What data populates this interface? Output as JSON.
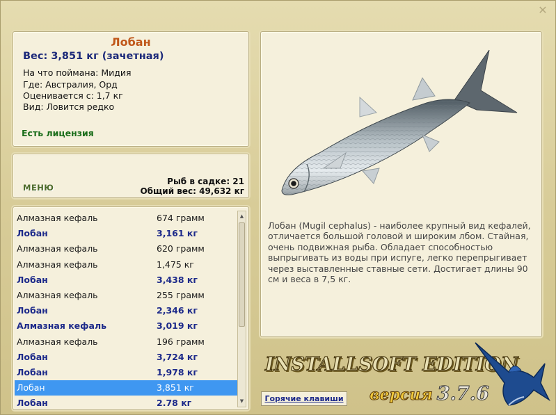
{
  "info": {
    "fish_name": "Лобан",
    "weight_line": "Вес: 3,851 кг (зачетная)",
    "caught_on": "На что поймана: Мидия",
    "location": "Где: Австралия, Орд",
    "valued_from": "Оценивается с: 1,7 кг",
    "kind": "Вид: Ловится редко",
    "license": "Есть лицензия"
  },
  "stats": {
    "menu_label": "МЕНЮ",
    "fish_in_keepnet": "Рыб в садке: 21",
    "total_weight": "Общий вес: 49,632 кг"
  },
  "catch_list": [
    {
      "name": "Алмазная кефаль",
      "weight": "674 грамм",
      "style": "normal"
    },
    {
      "name": "Лобан",
      "weight": "3,161 кг",
      "style": "bold"
    },
    {
      "name": "Алмазная кефаль",
      "weight": "620 грамм",
      "style": "normal"
    },
    {
      "name": "Алмазная кефаль",
      "weight": "1,475 кг",
      "style": "normal"
    },
    {
      "name": "Лобан",
      "weight": "3,438 кг",
      "style": "bold"
    },
    {
      "name": "Алмазная кефаль",
      "weight": "255 грамм",
      "style": "normal"
    },
    {
      "name": "Лобан",
      "weight": "2,346 кг",
      "style": "bold"
    },
    {
      "name": "Алмазная кефаль",
      "weight": "3,019 кг",
      "style": "bold"
    },
    {
      "name": "Алмазная кефаль",
      "weight": "196 грамм",
      "style": "normal"
    },
    {
      "name": "Лобан",
      "weight": "3,724 кг",
      "style": "bold"
    },
    {
      "name": "Лобан",
      "weight": "1,978 кг",
      "style": "bold"
    },
    {
      "name": "Лобан",
      "weight": "3,851 кг",
      "style": "sel"
    },
    {
      "name": "Лобан",
      "weight": "2.78 кг",
      "style": "bold"
    }
  ],
  "fish": {
    "description": "Лобан (Mugil cephalus) - наиболее крупный вид кефалей, отличается большой головой и широким лбом. Стайная, очень подвижная рыба. Обладает способностью выпрыгивать из воды при испуге, легко перепрыгивает через выставленные ставные сети. Достигает длины 90 см и веса в 7,5 кг.",
    "image_icon": "fish-image"
  },
  "footer": {
    "hotkeys_label": "Горячие клавиши",
    "brand": "INSTALLSOFT EDITION",
    "version_word": "версия",
    "version_num": "3.7.6"
  },
  "colors": {
    "selection": "#3f97f1",
    "title": "#c0571a",
    "bold_name": "#1d2a8a",
    "license": "#1a6d1a"
  }
}
